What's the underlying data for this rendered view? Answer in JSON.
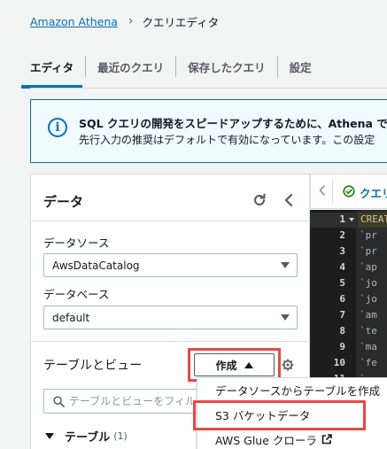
{
  "breadcrumb": {
    "root": "Amazon Athena",
    "current": "クエリエディタ"
  },
  "tabs": [
    {
      "label": "エディタ",
      "active": true
    },
    {
      "label": "最近のクエリ",
      "active": false
    },
    {
      "label": "保存したクエリ",
      "active": false
    },
    {
      "label": "設定",
      "active": false
    }
  ],
  "alert": {
    "title": "SQL クエリの開発をスピードアップするために、Athena で先",
    "body": "先行入力の推奨はデフォルトで有効になっています。この設定"
  },
  "data_panel": {
    "title": "データ",
    "datasource_label": "データソース",
    "datasource_value": "AwsDataCatalog",
    "database_label": "データベース",
    "database_value": "default",
    "tables_label": "テーブルとビュー",
    "create_label": "作成",
    "search_placeholder": "テーブルとビューをフィルタリング",
    "tables_group": {
      "label": "テーブル",
      "count": "(1)"
    }
  },
  "editor": {
    "tab_label": "クエリ",
    "line_numbers": [
      "1",
      "2",
      "3",
      "4",
      "5",
      "6",
      "7",
      "8",
      "9",
      "10",
      "11"
    ],
    "lines": [
      "CREATE",
      "`pr",
      "`pr",
      "`ap",
      "`jo",
      "`jo",
      "`am",
      "`te",
      "`ma",
      "`fe",
      "`"
    ]
  },
  "create_menu": {
    "items": [
      {
        "label": "データソースからテーブルを作成",
        "external": false
      },
      {
        "label": "S3 バケットデータ",
        "external": false
      },
      {
        "label": "AWS Glue クローラ",
        "external": true
      }
    ]
  },
  "colors": {
    "accent": "#0073bb",
    "highlight": "#e84848"
  }
}
